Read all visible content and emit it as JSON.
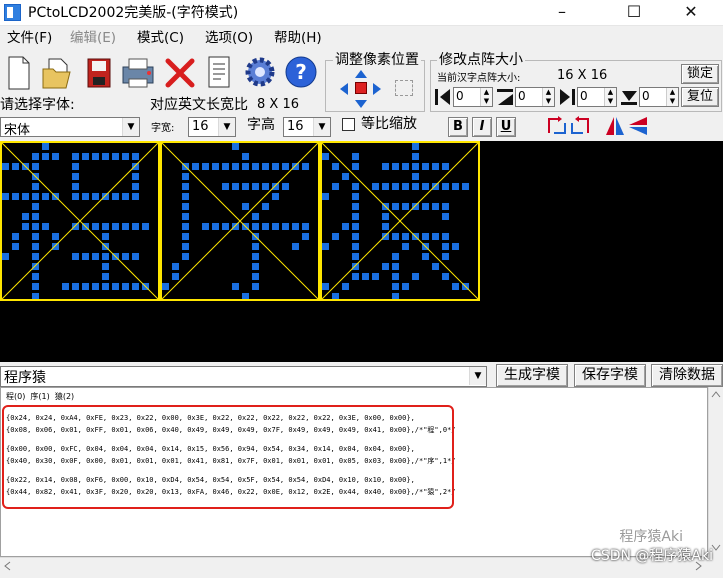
{
  "window": {
    "title": "PCtoLCD2002完美版-(字符模式)",
    "controls": [
      "–",
      "☐",
      "✕"
    ]
  },
  "menu": [
    {
      "label": "文件(F)",
      "disabled": false
    },
    {
      "label": "编辑(E)",
      "disabled": true
    },
    {
      "label": "模式(C)",
      "disabled": false
    },
    {
      "label": "选项(O)",
      "disabled": false
    },
    {
      "label": "帮助(H)",
      "disabled": false
    }
  ],
  "toolbar": {
    "icons": [
      "new-file-icon",
      "open-folder-icon",
      "save-icon",
      "print-icon",
      "delete-icon",
      "notes-icon",
      "settings-gear-icon",
      "help-icon"
    ],
    "help_glyph": "?",
    "delete_glyph": "✕"
  },
  "position_group": {
    "title": "调整像素位置"
  },
  "resize_group": {
    "title": "修改点阵大小",
    "current_label": "当前汉字点阵大小:",
    "current_size": "16  X  16",
    "confirm_label": "锁定",
    "restore_label": "复位",
    "spinners": [
      "0",
      "0",
      "0",
      "0"
    ]
  },
  "font": {
    "choose_label": "请选择字体:",
    "family": "宋体",
    "ratio_label": "对应英文长宽比",
    "ratio_value": "8  X  16",
    "width_label": "字宽:",
    "width_value": "16",
    "height_label": "字高",
    "height_value": "16",
    "proportional_label": "等比缩放",
    "bold": "B",
    "italic": "I",
    "underline": "U"
  },
  "input": {
    "text": "程序猿",
    "generate_label": "生成字模",
    "save_label": "保存字模",
    "clear_label": "清除数据"
  },
  "glyph_index_line": "程(0)  序(1)  猿(2)",
  "output_code": [
    "{0x24, 0x24, 0xA4, 0xFE, 0x23, 0x22, 0x00, 0x3E, 0x22, 0x22, 0x22, 0x22, 0x22, 0x3E, 0x00, 0x00},",
    "{0x08, 0x06, 0x01, 0xFF, 0x01, 0x06, 0x40, 0x49, 0x49, 0x49, 0x7F, 0x49, 0x49, 0x49, 0x41, 0x00},/*\"程\",0*/",
    "",
    "{0x00, 0x00, 0xFC, 0x04, 0x04, 0x04, 0x14, 0x15, 0x56, 0x94, 0x54, 0x34, 0x14, 0x04, 0x04, 0x00},",
    "{0x40, 0x30, 0x0F, 0x00, 0x01, 0x01, 0x01, 0x41, 0x81, 0x7F, 0x01, 0x01, 0x01, 0x05, 0x03, 0x00},/*\"序\",1*/",
    "",
    "{0x22, 0x14, 0x08, 0xF6, 0x00, 0x10, 0xD4, 0x54, 0x54, 0x5F, 0x54, 0x54, 0xD4, 0x10, 0x10, 0x00},",
    "{0x44, 0x82, 0x41, 0x3F, 0x20, 0x20, 0x13, 0xFA, 0x46, 0x22, 0x0E, 0x12, 0x2E, 0x44, 0x40, 0x00},/*\"猿\",2*/"
  ],
  "watermark": {
    "wechat": "程序猿Aki",
    "csdn": "CSDN @程序猿Aki"
  },
  "colors": {
    "pixel_on": "#1a6fe0",
    "cell_border": "#ffe600",
    "diagonal": "#ffe600",
    "highlight": "#e0201a"
  }
}
